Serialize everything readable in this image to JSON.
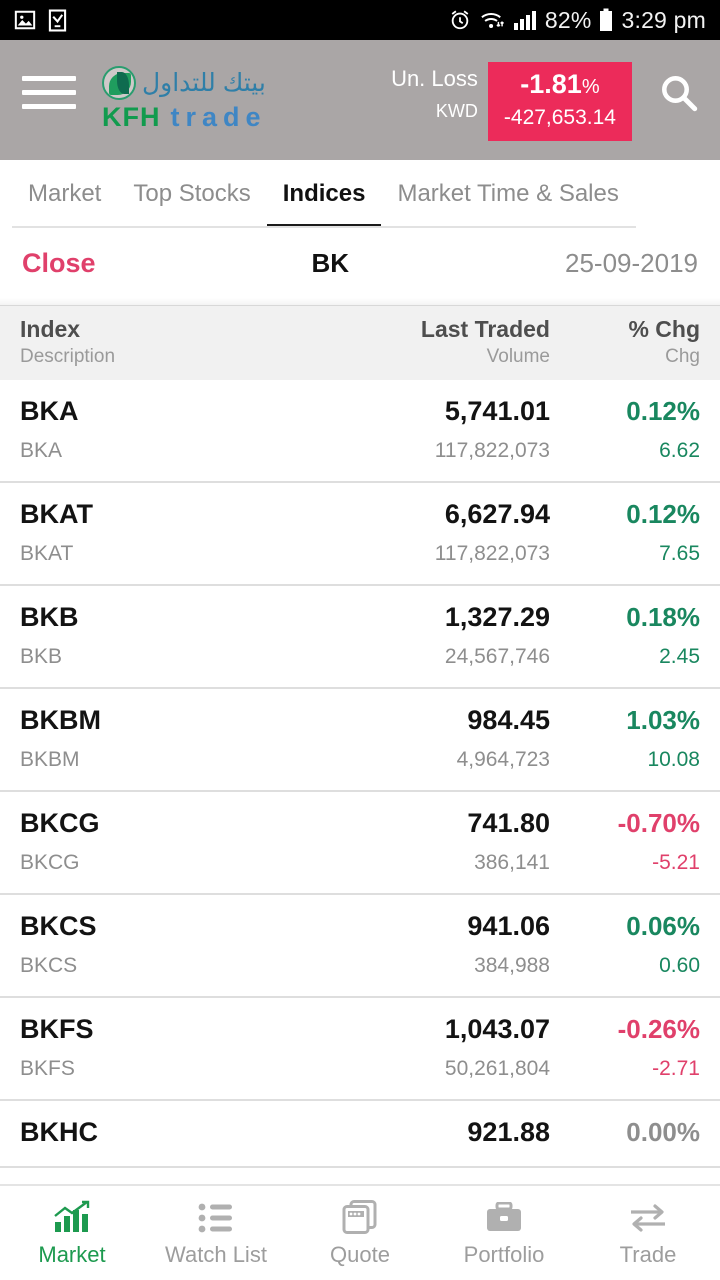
{
  "statusbar": {
    "icons_left": [
      "image-icon",
      "document-check-icon"
    ],
    "icons_right": [
      "alarm-icon",
      "wifi-icon",
      "signal-icon",
      "battery-icon"
    ],
    "battery": "82%",
    "time": "3:29 pm"
  },
  "header": {
    "menu_icon": "hamburger-menu-icon",
    "logo_arabic": "بيتك للتداول",
    "logo_kfh": "KFH",
    "logo_trade": "trade",
    "pnl_label": "Un. Loss",
    "currency": "KWD",
    "pnl_percent": "-1.81",
    "pnl_percent_symbol": "%",
    "pnl_value": "-427,653.14",
    "pnl_color": "#ec2b5a",
    "search_icon": "search-icon"
  },
  "tabs": [
    {
      "label": "Market",
      "active": false
    },
    {
      "label": "Top Stocks",
      "active": false
    },
    {
      "label": "Indices",
      "active": true
    },
    {
      "label": "Market Time & Sales",
      "active": false
    }
  ],
  "filterbar": {
    "close_label": "Close",
    "market_label": "BK",
    "date": "25-09-2019"
  },
  "columns": {
    "index_main": "Index",
    "index_sub": "Description",
    "last_main": "Last Traded",
    "last_sub": "Volume",
    "chg_main": "% Chg",
    "chg_sub": "Chg"
  },
  "rows": [
    {
      "symbol": "BKA",
      "description": "BKA",
      "last": "5,741.01",
      "volume": "117,822,073",
      "pct": "0.12%",
      "chg": "6.62",
      "dir": "up"
    },
    {
      "symbol": "BKAT",
      "description": "BKAT",
      "last": "6,627.94",
      "volume": "117,822,073",
      "pct": "0.12%",
      "chg": "7.65",
      "dir": "up"
    },
    {
      "symbol": "BKB",
      "description": "BKB",
      "last": "1,327.29",
      "volume": "24,567,746",
      "pct": "0.18%",
      "chg": "2.45",
      "dir": "up"
    },
    {
      "symbol": "BKBM",
      "description": "BKBM",
      "last": "984.45",
      "volume": "4,964,723",
      "pct": "1.03%",
      "chg": "10.08",
      "dir": "up"
    },
    {
      "symbol": "BKCG",
      "description": "BKCG",
      "last": "741.80",
      "volume": "386,141",
      "pct": "-0.70%",
      "chg": "-5.21",
      "dir": "down"
    },
    {
      "symbol": "BKCS",
      "description": "BKCS",
      "last": "941.06",
      "volume": "384,988",
      "pct": "0.06%",
      "chg": "0.60",
      "dir": "up"
    },
    {
      "symbol": "BKFS",
      "description": "BKFS",
      "last": "1,043.07",
      "volume": "50,261,804",
      "pct": "-0.26%",
      "chg": "-2.71",
      "dir": "down"
    },
    {
      "symbol": "BKHC",
      "description": "BKHC",
      "last": "921.88",
      "volume": "",
      "pct": "0.00%",
      "chg": "",
      "dir": "flat"
    }
  ],
  "bottomnav": [
    {
      "label": "Market",
      "icon": "bar-chart-icon",
      "active": true
    },
    {
      "label": "Watch List",
      "icon": "list-icon",
      "active": false
    },
    {
      "label": "Quote",
      "icon": "cards-icon",
      "active": false
    },
    {
      "label": "Portfolio",
      "icon": "briefcase-icon",
      "active": false
    },
    {
      "label": "Trade",
      "icon": "exchange-icon",
      "active": false
    }
  ],
  "colors": {
    "up": "#19875f",
    "down": "#e0406b",
    "accent_green": "#1d9a4f",
    "header_bg": "#aaa6a6"
  }
}
